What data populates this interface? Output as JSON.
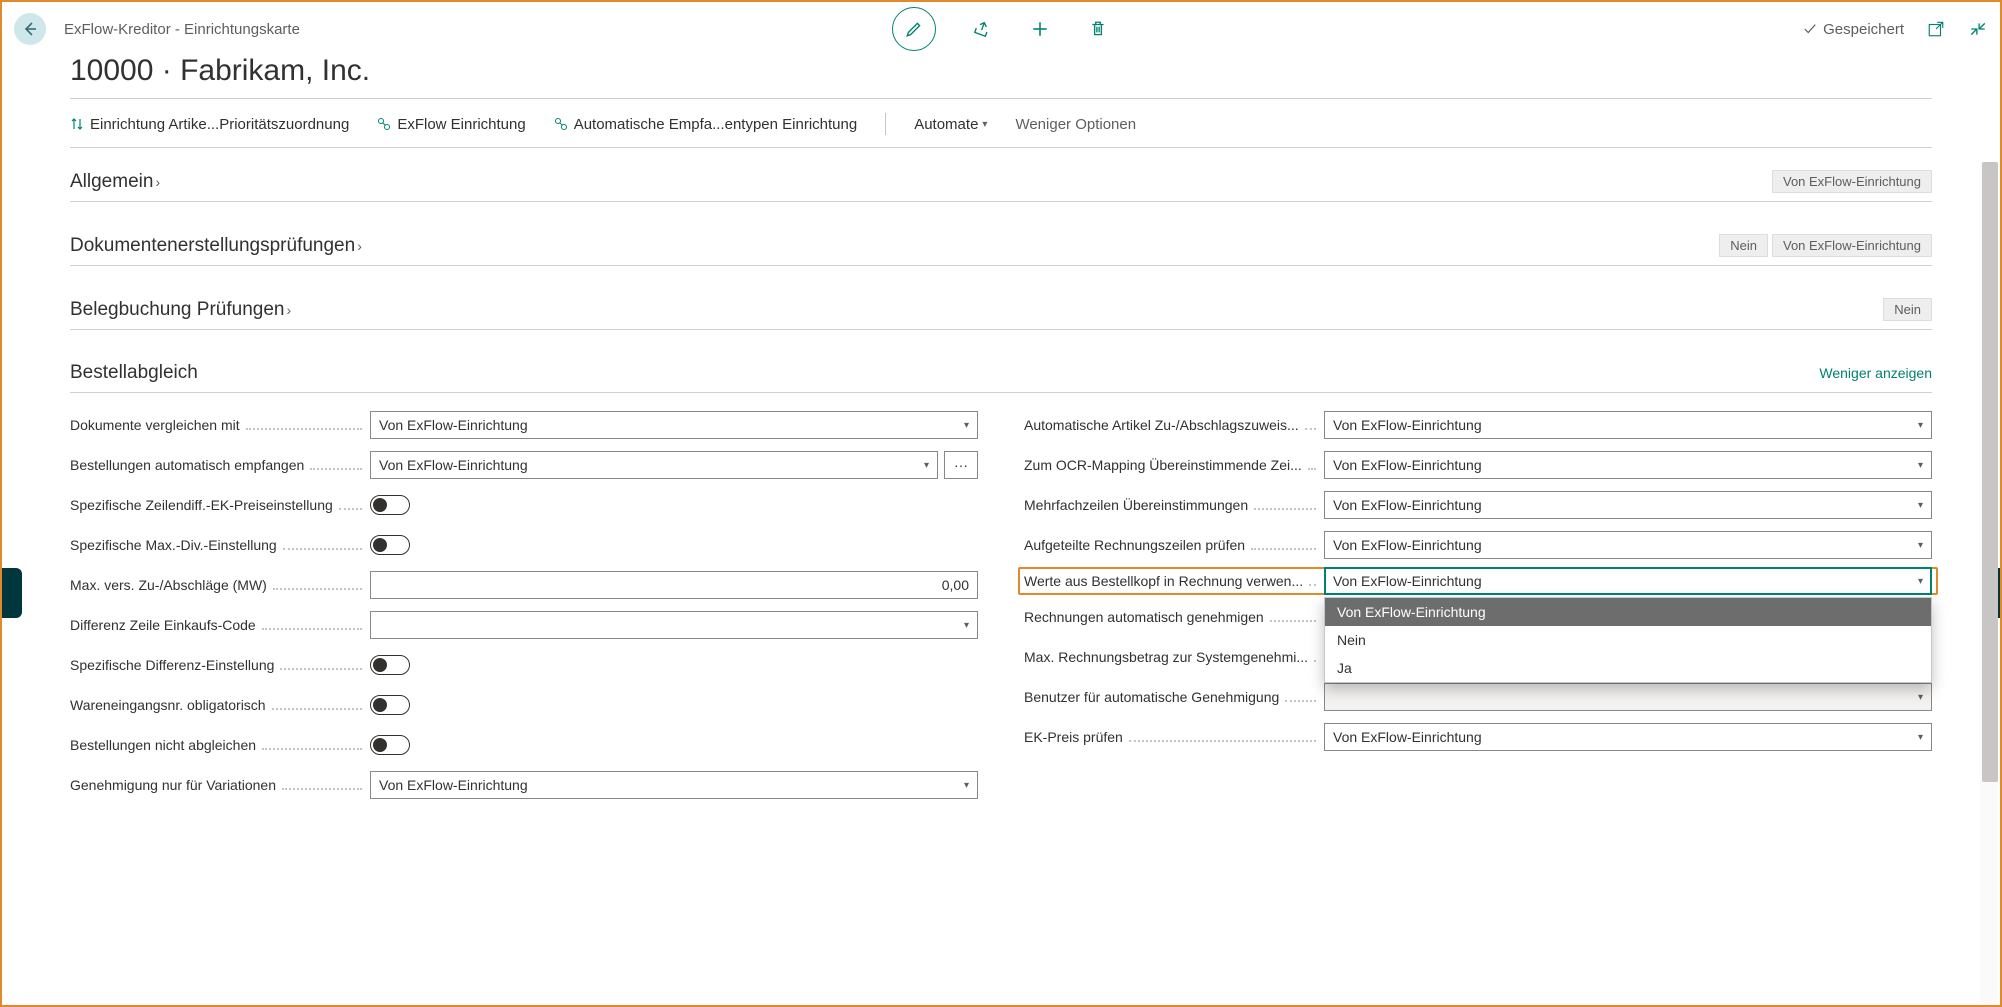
{
  "header": {
    "crumb": "ExFlow-Kreditor - Einrichtungskarte",
    "title": "10000 · Fabrikam, Inc.",
    "saved": "Gespeichert"
  },
  "toolbar": {
    "action1": "Einrichtung Artike...Prioritätszuordnung",
    "action2": "ExFlow Einrichtung",
    "action3": "Automatische Empfa...entypen Einrichtung",
    "automate": "Automate",
    "less": "Weniger Optionen"
  },
  "sections": {
    "general": {
      "title": "Allgemein",
      "badge1": "Von ExFlow-Einrichtung"
    },
    "docchecks": {
      "title": "Dokumentenerstellungsprüfungen",
      "badge_nein": "Nein",
      "badge_setup": "Von ExFlow-Einrichtung"
    },
    "posting": {
      "title": "Belegbuchung Prüfungen",
      "badge_nein": "Nein"
    },
    "match": {
      "title": "Bestellabgleich",
      "show_less": "Weniger anzeigen"
    }
  },
  "left": {
    "f1": {
      "label": "Dokumente vergleichen mit",
      "value": "Von ExFlow-Einrichtung"
    },
    "f2": {
      "label": "Bestellungen automatisch empfangen",
      "value": "Von ExFlow-Einrichtung"
    },
    "f3": {
      "label": "Spezifische Zeilendiff.-EK-Preiseinstellung"
    },
    "f4": {
      "label": "Spezifische Max.-Div.-Einstellung"
    },
    "f5": {
      "label": "Max. vers. Zu-/Abschläge (MW)",
      "value": "0,00"
    },
    "f6": {
      "label": "Differenz Zeile Einkaufs-Code",
      "value": ""
    },
    "f7": {
      "label": "Spezifische Differenz-Einstellung"
    },
    "f8": {
      "label": "Wareneingangsnr. obligatorisch"
    },
    "f9": {
      "label": "Bestellungen nicht abgleichen"
    },
    "f10": {
      "label": "Genehmigung nur für Variationen",
      "value": "Von ExFlow-Einrichtung"
    }
  },
  "right": {
    "f1": {
      "label": "Automatische Artikel Zu-/Abschlagszuweis...",
      "value": "Von ExFlow-Einrichtung"
    },
    "f2": {
      "label": "Zum OCR-Mapping Übereinstimmende Zei...",
      "value": "Von ExFlow-Einrichtung"
    },
    "f3": {
      "label": "Mehrfachzeilen Übereinstimmungen",
      "value": "Von ExFlow-Einrichtung"
    },
    "f4": {
      "label": "Aufgeteilte Rechnungszeilen prüfen",
      "value": "Von ExFlow-Einrichtung"
    },
    "f5": {
      "label": "Werte aus Bestellkopf in Rechnung verwen...",
      "value": "Von ExFlow-Einrichtung"
    },
    "f6": {
      "label": "Rechnungen automatisch genehmigen"
    },
    "f7": {
      "label": "Max. Rechnungsbetrag zur Systemgenehmi..."
    },
    "f8": {
      "label": "Benutzer für automatische Genehmigung",
      "value": ""
    },
    "f9": {
      "label": "EK-Preis prüfen",
      "value": "Von ExFlow-Einrichtung"
    }
  },
  "dropdown": {
    "opt1": "Von ExFlow-Einrichtung",
    "opt2": "Nein",
    "opt3": "Ja"
  }
}
